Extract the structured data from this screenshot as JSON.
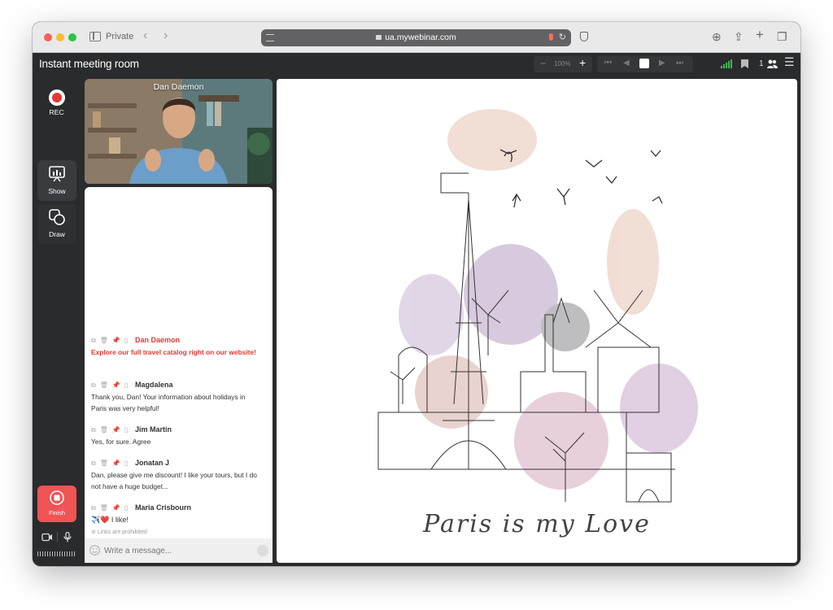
{
  "browser": {
    "mode_label": "Private",
    "url": "ua.mywebinar.com"
  },
  "app": {
    "title": "Instant meeting room",
    "zoom_level": "100%",
    "participants_count": "1"
  },
  "left_sidebar": {
    "rec_label": "REC",
    "show_label": "Show",
    "draw_label": "Draw",
    "finish_label": "Finish"
  },
  "video": {
    "presenter_name": "Dan Daemon"
  },
  "chat": {
    "messages": [
      {
        "author": "Dan Daemon",
        "text": "Explore our full travel catalog right on our website!",
        "highlight": true
      },
      {
        "author": "Magdalena",
        "text": "Thank you, Dan! Your information about holidays in Paris was very helpful!"
      },
      {
        "author": "Jim Martin",
        "text": "Yes, for sure. Agree"
      },
      {
        "author": "Jonatan J",
        "text": "Dan, please give me discount! I like your tours, but I do not have a huge budget..."
      },
      {
        "author": "Maria Crisbourn",
        "text": "✈️❤️ I like!"
      }
    ],
    "links_notice": "Links are prohibited",
    "input_placeholder": "Write a message..."
  },
  "slide": {
    "caption": "Paris is my Love"
  },
  "colors": {
    "record_red": "#e53935",
    "finish_red": "#f05454",
    "highlight_text": "#e53935",
    "signal_green": "#3fb950"
  }
}
